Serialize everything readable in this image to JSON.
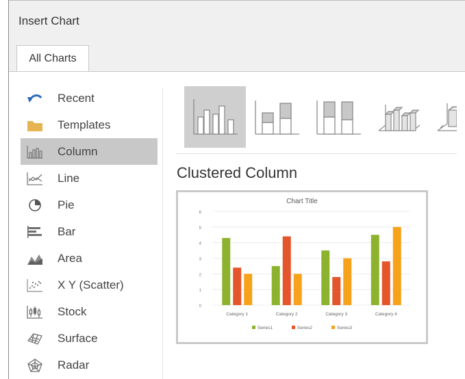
{
  "dialog": {
    "title": "Insert Chart"
  },
  "tabs": [
    {
      "label": "All Charts"
    }
  ],
  "sidebar": {
    "items": [
      {
        "label": "Recent",
        "icon": "recent-icon"
      },
      {
        "label": "Templates",
        "icon": "templates-icon"
      },
      {
        "label": "Column",
        "icon": "column-chart-icon",
        "selected": true
      },
      {
        "label": "Line",
        "icon": "line-chart-icon"
      },
      {
        "label": "Pie",
        "icon": "pie-chart-icon"
      },
      {
        "label": "Bar",
        "icon": "bar-chart-icon"
      },
      {
        "label": "Area",
        "icon": "area-chart-icon"
      },
      {
        "label": "X Y (Scatter)",
        "icon": "scatter-chart-icon"
      },
      {
        "label": "Stock",
        "icon": "stock-chart-icon"
      },
      {
        "label": "Surface",
        "icon": "surface-chart-icon"
      },
      {
        "label": "Radar",
        "icon": "radar-chart-icon"
      }
    ]
  },
  "subtypes": [
    {
      "icon": "clustered-column-icon",
      "selected": true
    },
    {
      "icon": "stacked-column-icon"
    },
    {
      "icon": "100-stacked-column-icon"
    },
    {
      "icon": "3d-clustered-column-icon"
    },
    {
      "icon": "3d-column-icon"
    }
  ],
  "selected_subtype_title": "Clustered Column",
  "chart_data": {
    "type": "bar",
    "title": "Chart Title",
    "categories": [
      "Category 1",
      "Category 2",
      "Category 3",
      "Category 4"
    ],
    "series": [
      {
        "name": "Series1",
        "color": "#8db32e",
        "values": [
          4.3,
          2.5,
          3.5,
          4.5
        ]
      },
      {
        "name": "Series2",
        "color": "#e4552b",
        "values": [
          2.4,
          4.4,
          1.8,
          2.8
        ]
      },
      {
        "name": "Series3",
        "color": "#f7a21b",
        "values": [
          2.0,
          2.0,
          3.0,
          5.0
        ]
      }
    ],
    "ylim": [
      0,
      6
    ],
    "yticks": [
      "0",
      "1",
      "2",
      "3",
      "4",
      "5",
      "6"
    ],
    "grid": true,
    "legend": "bottom"
  }
}
